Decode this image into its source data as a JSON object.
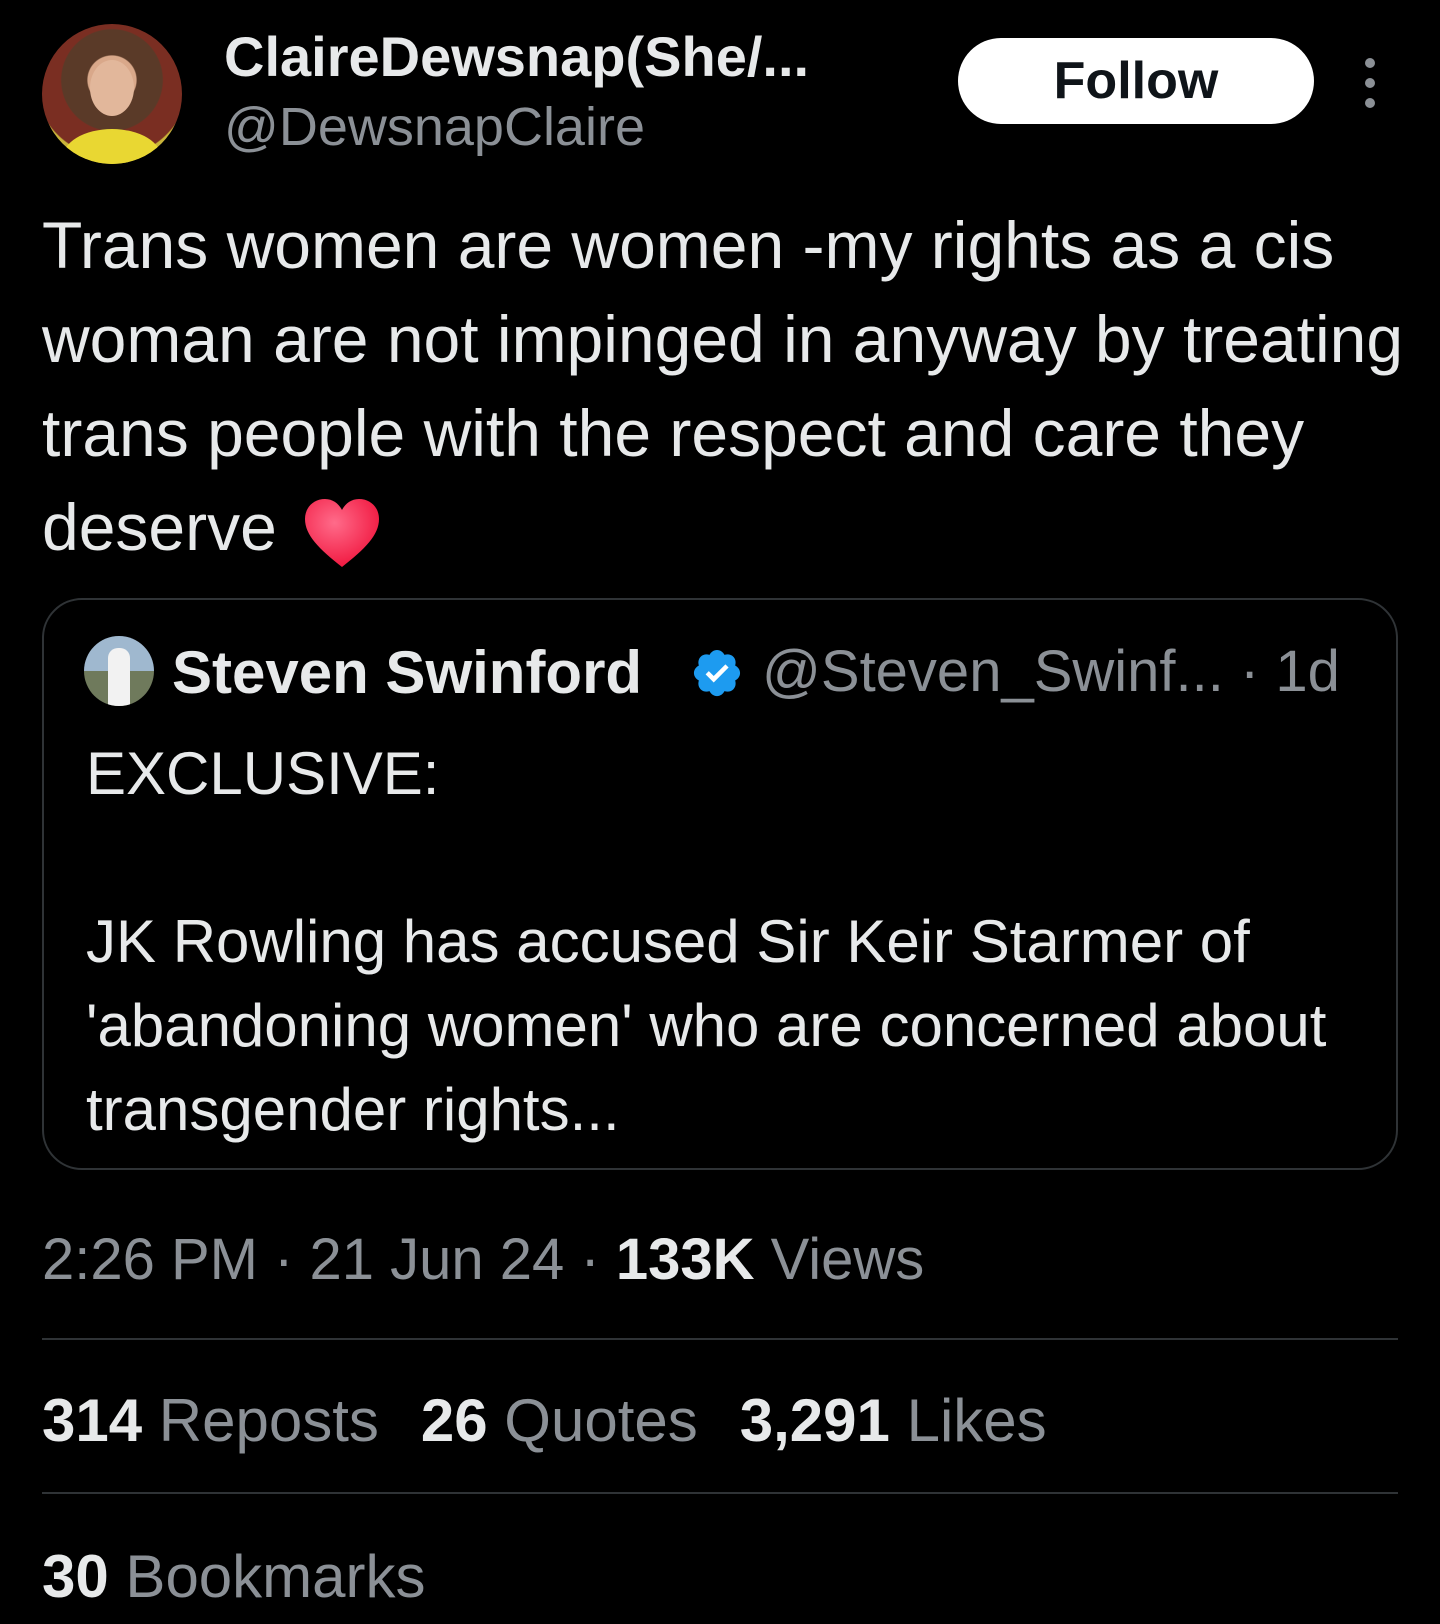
{
  "author": {
    "display_name": "ClaireDewsnap(She/...",
    "handle": "@DewsnapClaire",
    "follow_label": "Follow"
  },
  "tweet": {
    "text": "Trans women are women -my rights as a cis woman are not impinged in anyway by treating trans people with the respect and care they deserve",
    "emoji_icon": "red-heart-icon"
  },
  "quoted": {
    "name": "Steven Swinford",
    "handle_time": "@Steven_Swinf... · 1d",
    "line1": "EXCLUSIVE:",
    "line2": "JK Rowling has accused Sir Keir Starmer of 'abandoning women' who are concerned about transgender rights..."
  },
  "meta": {
    "time": "2:26 PM",
    "sep1": " · ",
    "date": "21 Jun 24",
    "sep2": " · ",
    "views_count": "133K",
    "views_label": " Views"
  },
  "stats": {
    "reposts_count": "314",
    "reposts_label": " Reposts",
    "quotes_count": "26",
    "quotes_label": " Quotes",
    "likes_count": "3,291",
    "likes_label": " Likes",
    "bookmarks_count": "30",
    "bookmarks_label": " Bookmarks"
  },
  "colors": {
    "background": "#000000",
    "text": "#e7e9ea",
    "secondary": "#8b9096",
    "verified": "#1d9bf0",
    "heart": "#ff2d55"
  }
}
